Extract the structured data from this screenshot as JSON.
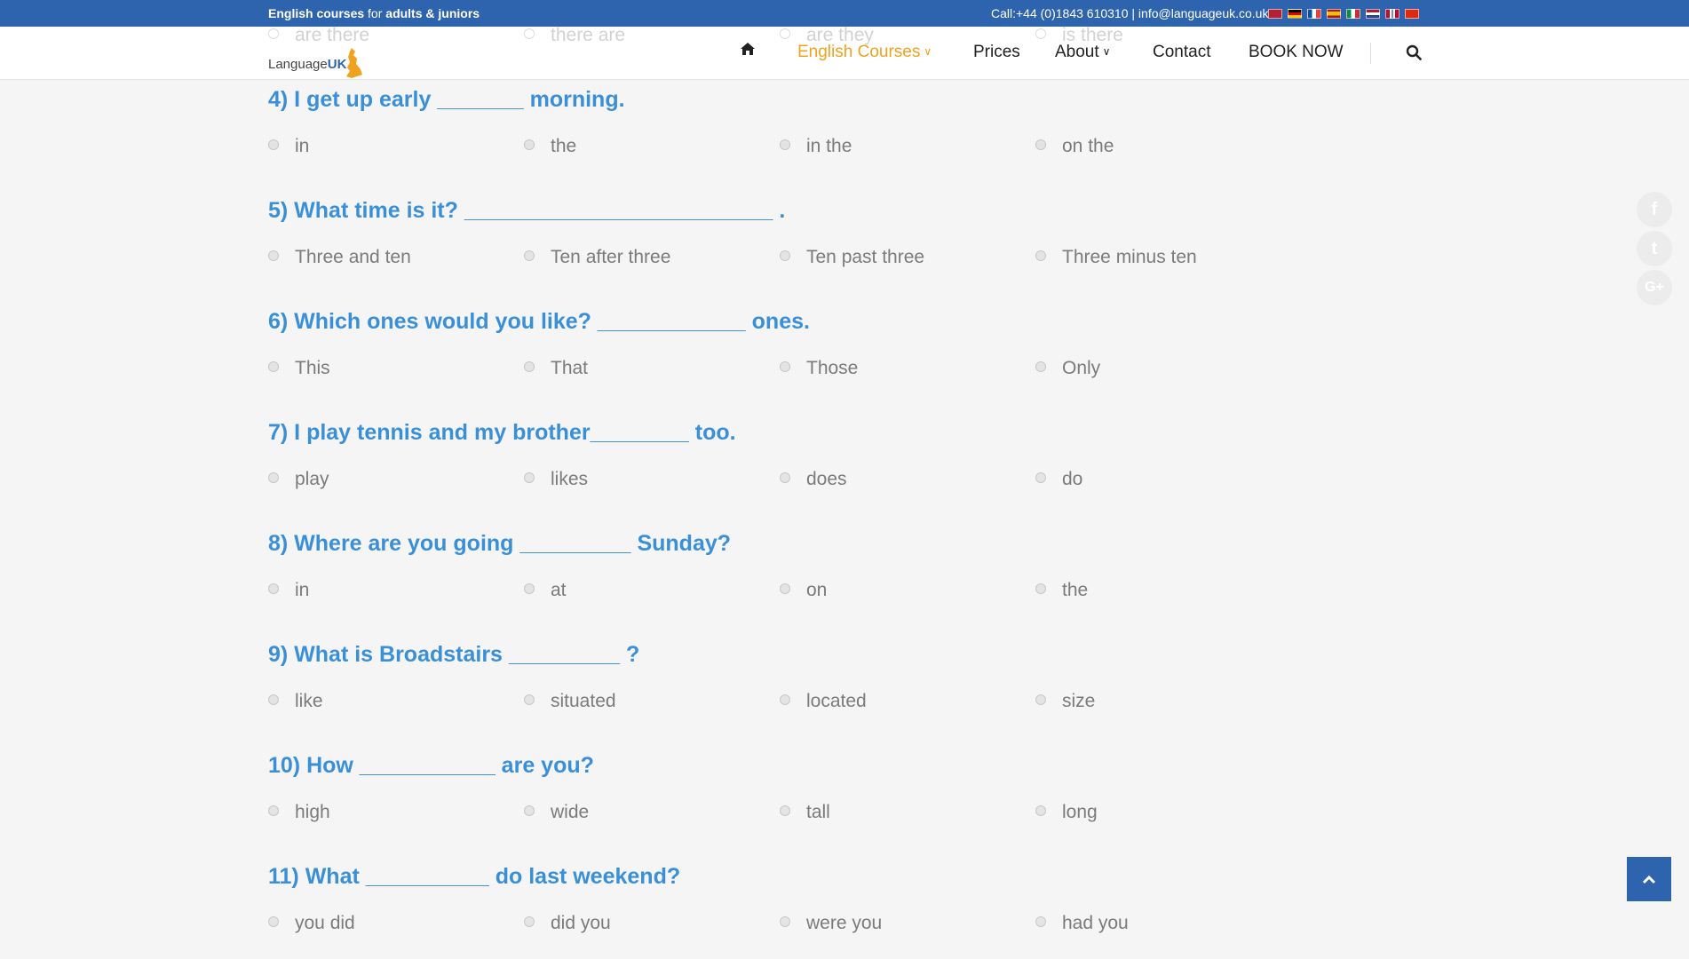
{
  "topbar": {
    "tagline_bold1": "English courses",
    "tagline_mid": " for ",
    "tagline_bold2": "adults & juniors",
    "contact": "Call:+44 (0)1843 610310 | info@languageuk.co.uk",
    "flags": [
      {
        "name": "us-flag-icon",
        "color": "#b22234"
      },
      {
        "name": "de-flag-icon",
        "color": "#dd0000"
      },
      {
        "name": "fr-flag-icon",
        "color": "#0055a4"
      },
      {
        "name": "es-flag-icon",
        "color": "#f1bf00"
      },
      {
        "name": "it-flag-icon",
        "color": "#009246"
      },
      {
        "name": "nl-flag-icon",
        "color": "#ae1c28"
      },
      {
        "name": "no-flag-icon",
        "color": "#ba0c2f"
      },
      {
        "name": "cn-flag-icon",
        "color": "#de2910"
      }
    ]
  },
  "header": {
    "logo_text": "Language",
    "logo_uk": "UK",
    "ghost_options": [
      "are there",
      "there are",
      "are they",
      "is there"
    ]
  },
  "nav": {
    "home_icon": "home-icon",
    "english_courses": "English Courses",
    "prices": "Prices",
    "about": "About",
    "contact": "Contact",
    "book_now": "BOOK NOW",
    "search_icon": "search-icon"
  },
  "quiz": [
    {
      "question": "4) I get up early _______ morning.",
      "options": [
        "in",
        "the",
        "in the",
        "on the"
      ]
    },
    {
      "question": "5) What time is it? _________________________ .",
      "options": [
        "Three and ten",
        "Ten after three",
        "Ten past three",
        "Three minus ten"
      ]
    },
    {
      "question": "6) Which ones would you like? ____________ ones.",
      "options": [
        "This",
        "That",
        "Those",
        "Only"
      ]
    },
    {
      "question": "7) I play tennis and my brother________ too.",
      "options": [
        "play",
        "likes",
        "does",
        "do"
      ]
    },
    {
      "question": "8) Where are you going _________ Sunday?",
      "options": [
        "in",
        "at",
        "on",
        "the"
      ]
    },
    {
      "question": "9) What is Broadstairs _________ ?",
      "options": [
        "like",
        "situated",
        "located",
        "size"
      ]
    },
    {
      "question": "10) How ___________ are you?",
      "options": [
        "high",
        "wide",
        "tall",
        "long"
      ]
    },
    {
      "question": "11) What __________ do last weekend?",
      "options": [
        "you did",
        "did you",
        "were you",
        "had you"
      ]
    }
  ],
  "social": [
    {
      "name": "facebook-icon",
      "glyph": "f"
    },
    {
      "name": "twitter-icon",
      "glyph": "t"
    },
    {
      "name": "google-plus-icon",
      "glyph": "G+"
    }
  ],
  "colors": {
    "brand_blue": "#2e63ae",
    "accent_orange": "#f0a21e",
    "question_blue": "#3a8fd9"
  }
}
